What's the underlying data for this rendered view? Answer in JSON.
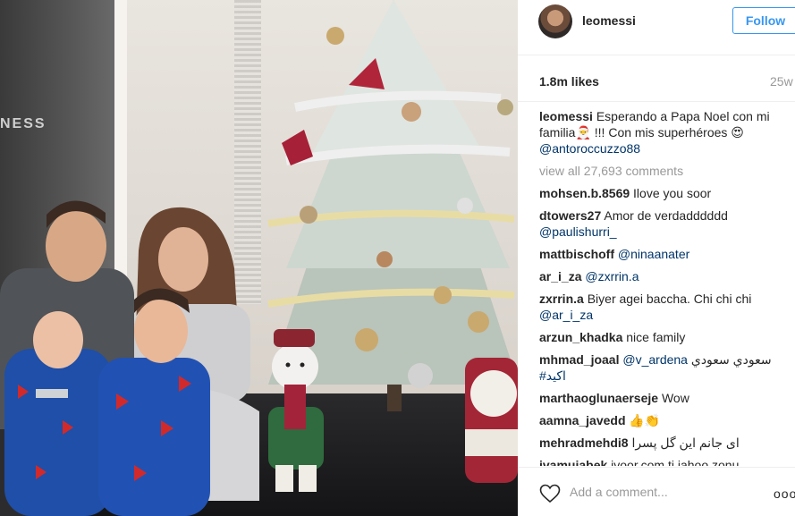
{
  "photo": {
    "wall_text": "NESS"
  },
  "post": {
    "username": "leomessi",
    "follow_label": "Follow",
    "likes": "1.8m likes",
    "time": "25w"
  },
  "caption": {
    "user": "leomessi",
    "text": "Esperando a Papa Noel con mi familia🎅 !!! Con mis superhéroes 😍",
    "mention": "@antoroccuzzo88"
  },
  "view_all": "view all 27,693 comments",
  "comments": [
    {
      "user": "mohsen.b.8569",
      "text": "Ilove you soor",
      "mention": ""
    },
    {
      "user": "dtowers27",
      "text": "Amor de verdadddddd",
      "mention": "@paulishurri_"
    },
    {
      "user": "mattbischoff",
      "text": "",
      "mention": "@ninaanater"
    },
    {
      "user": "ar_i_za",
      "text": "",
      "mention": "@zxrrin.a"
    },
    {
      "user": "zxrrin.a",
      "text": "Biyer agei baccha. Chi chi chi",
      "mention": "@ar_i_za"
    },
    {
      "user": "arzun_khadka",
      "text": "nice family",
      "mention": ""
    },
    {
      "user": "mhmad_joaal",
      "text": "سعودي سعودي",
      "mention": "@v_ardena",
      "extra": "#اكيد"
    },
    {
      "user": "marthaoglunaerseje",
      "text": "Wow",
      "mention": ""
    },
    {
      "user": "aamna_javedd",
      "text": "👍👏",
      "mention": ""
    },
    {
      "user": "mehradmehdi8",
      "text": "ای جانم این گل پسرا",
      "mention": ""
    },
    {
      "user": "jvamuiabek",
      "text": "ivoor.com ti jahoo zonu",
      "mention": ""
    }
  ],
  "add_comment_placeholder": "Add a comment...",
  "more_label": "ooo",
  "icons": {
    "heart": "heart-outline-icon",
    "more": "more-options-icon"
  },
  "colors": {
    "link_blue": "#003569",
    "follow_blue": "#3897f0",
    "muted": "#999999"
  }
}
